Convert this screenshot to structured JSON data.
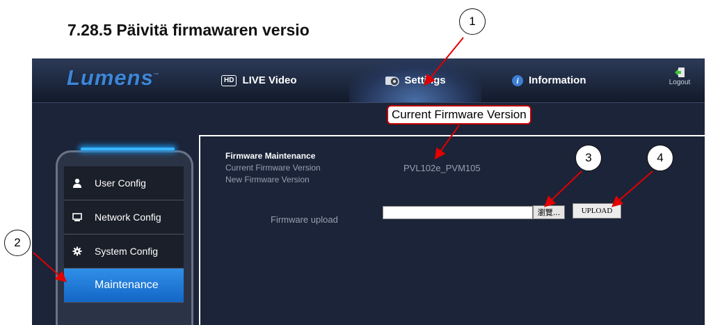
{
  "heading": "7.28.5  Päivitä firmawaren versio",
  "app": {
    "logo": "Lumens",
    "logo_tm": "™",
    "nav": {
      "live_badge": "HD",
      "live_label": "LIVE Video",
      "settings_label": "Settings",
      "info_label": "Information",
      "logout_label": "Logout"
    },
    "sidebar": {
      "items": [
        {
          "label": "User Config",
          "icon": "user-icon"
        },
        {
          "label": "Network Config",
          "icon": "monitor-icon"
        },
        {
          "label": "System Config",
          "icon": "gear-icon"
        },
        {
          "label": "Maintenance",
          "icon": "",
          "active": true
        }
      ]
    },
    "firmware": {
      "title": "Firmware Maintenance",
      "current_label": "Current Firmware Version",
      "new_label": "New Firmware Version",
      "current_value": "PVL102e_PVM105",
      "upload_label": "Firmware upload",
      "file_value": "",
      "browse_label": "瀏覽...",
      "upload_button": "UPLOAD"
    }
  },
  "annotations": {
    "callout": "Current Firmware Version",
    "markers": [
      "1",
      "2",
      "3",
      "4"
    ]
  },
  "colors": {
    "accent": "#2f8fe8",
    "callout_border": "#c00000",
    "arrow": "#e00000",
    "background": "#1b2438"
  }
}
